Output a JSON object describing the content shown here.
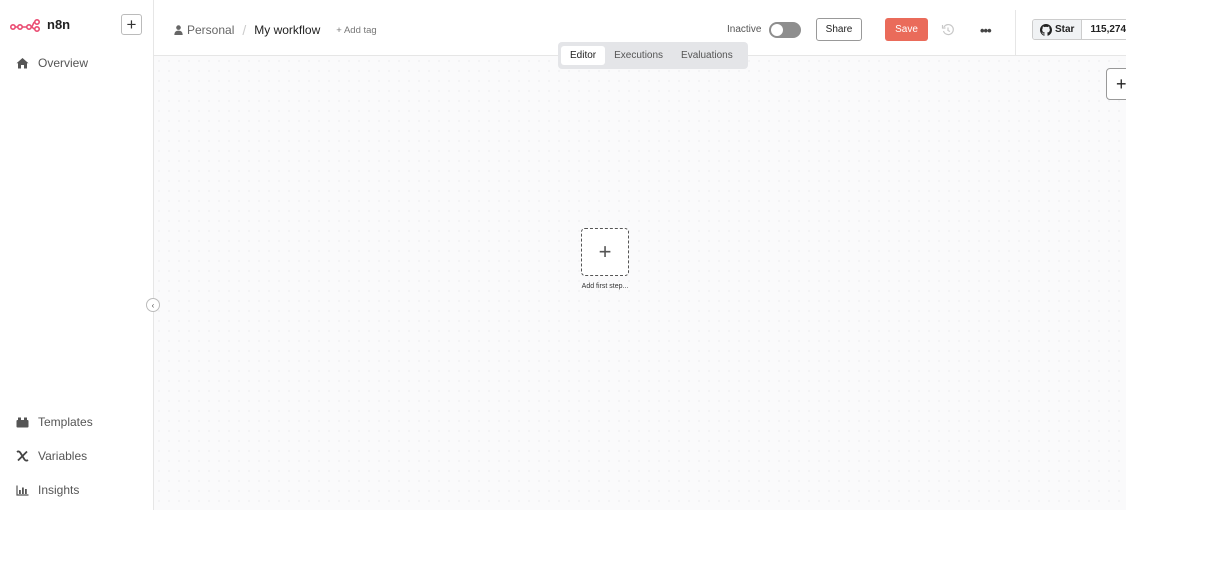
{
  "app": {
    "name": "n8n"
  },
  "sidebar": {
    "new_label": "+",
    "top_items": [
      {
        "label": "Overview",
        "icon": "home-icon"
      }
    ],
    "bottom_items": [
      {
        "label": "Templates",
        "icon": "templates-icon"
      },
      {
        "label": "Variables",
        "icon": "variables-icon"
      },
      {
        "label": "Insights",
        "icon": "insights-icon"
      }
    ],
    "collapse_label": "‹"
  },
  "header": {
    "project": "Personal",
    "separator": "/",
    "workflow_name": "My workflow",
    "add_tag": "+ Add tag",
    "status": "Inactive",
    "share_label": "Share",
    "save_label": "Save",
    "more_label": "•••",
    "github": {
      "star_label": "Star",
      "count": "115,274"
    }
  },
  "tabs": [
    {
      "label": "Editor",
      "active": true
    },
    {
      "label": "Executions",
      "active": false
    },
    {
      "label": "Evaluations",
      "active": false
    }
  ],
  "canvas": {
    "add_first_step": "Add first step...",
    "add_symbol": "+",
    "node_creator_symbol": "+"
  },
  "colors": {
    "accent": "#ea6b5a",
    "logo": "#ea4b71",
    "toggle_off": "#8e8e8e"
  }
}
